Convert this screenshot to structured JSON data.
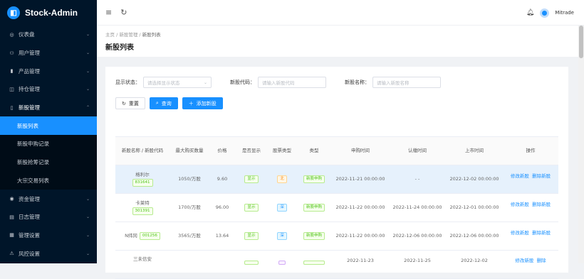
{
  "app": {
    "title": "Stock-Admin"
  },
  "sidebar": {
    "items": [
      {
        "label": "仪表盘",
        "icon": "dashboard-icon"
      },
      {
        "label": "用户管理",
        "icon": "users-icon"
      },
      {
        "label": "产品管理",
        "icon": "product-icon"
      },
      {
        "label": "持仓管理",
        "icon": "position-icon"
      },
      {
        "label": "新股管理",
        "icon": "ipo-icon"
      },
      {
        "label": "资金管理",
        "icon": "funds-icon"
      },
      {
        "label": "日志管理",
        "icon": "log-icon"
      },
      {
        "label": "管理设置",
        "icon": "settings-icon"
      },
      {
        "label": "风控设置",
        "icon": "risk-icon"
      }
    ],
    "subitems": [
      {
        "label": "新股列表"
      },
      {
        "label": "新股申购记录"
      },
      {
        "label": "新股抢筹记录"
      },
      {
        "label": "大宗交易列表"
      }
    ]
  },
  "topbar": {
    "user": "Mitrade"
  },
  "breadcrumb": {
    "home": "主页",
    "section": "新股管理",
    "current": "新股列表"
  },
  "page": {
    "title": "新股列表"
  },
  "filters": {
    "status_label": "显示状态：",
    "status_placeholder": "请选择显示状态",
    "code_label": "新股代码：",
    "code_placeholder": "请输入新股代码",
    "name_label": "新股名称：",
    "name_placeholder": "请输入新股名称"
  },
  "buttons": {
    "reset": "重置",
    "search": "查询",
    "add": "添加新股"
  },
  "table": {
    "headers": [
      "新股名称 / 新股代码",
      "最大购买数量",
      "价格",
      "是否显示",
      "股票类型",
      "类型",
      "申购时间",
      "认缴时间",
      "上市时间",
      "操作"
    ],
    "rows": [
      {
        "name": "格利尔",
        "code": "831641",
        "max": "1050/万股",
        "price": "9.60",
        "show": "显示",
        "stype": "北",
        "type": "新股申购",
        "apply": "2022-11-21 00:00:00",
        "subscribe": "- -",
        "listing": "2022-12-02 00:00:00",
        "op1": "修改新股",
        "op2": "删除新股"
      },
      {
        "name": "卡莱特",
        "code": "301391",
        "max": "1700/万股",
        "price": "96.00",
        "show": "显示",
        "stype": "深",
        "type": "新股申购",
        "apply": "2022-11-22 00:00:00",
        "subscribe": "2022-11-24 00:00:00",
        "listing": "2022-12-01 00:00:00",
        "op1": "修改新股",
        "op2": "删除新股"
      },
      {
        "name": "N纬冈",
        "code": "001256",
        "max": "3565/万股",
        "price": "13.64",
        "show": "显示",
        "stype": "深",
        "type": "新股申购",
        "apply": "2022-11-22 00:00:00",
        "subscribe": "2022-12-06 00:00:00",
        "listing": "2022-12-06 00:00:00",
        "op1": "修改新股",
        "op2": "删除新股"
      },
      {
        "name": "三未信安",
        "code": "",
        "max": "",
        "price": "",
        "show": "",
        "stype": "",
        "type": "",
        "apply": "2022-11-23",
        "subscribe": "2022-11-25",
        "listing": "2022-12-02",
        "op1": "修改新股",
        "op2": "删除"
      }
    ]
  },
  "colors": {
    "sidebar": "#001529",
    "primary": "#1890ff",
    "row_highlight": "#e6f1fc"
  }
}
